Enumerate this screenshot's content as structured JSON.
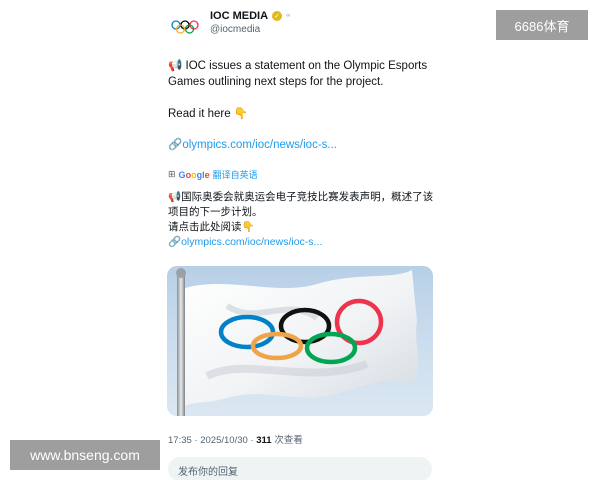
{
  "account": {
    "display_name": "IOC MEDIA",
    "handle": "@iocmedia",
    "verified_badge": "✓",
    "affiliate_badge": "∞"
  },
  "tweet": {
    "line1": "📢 IOC issues a statement on the Olympic Esports Games outlining next steps for the project.",
    "line2": "Read it here 👇",
    "link_prefix": "🔗",
    "link_text": "olympics.com/ioc/news/ioc-s..."
  },
  "translation": {
    "icon": "⊞",
    "google_letters": [
      "G",
      "o",
      "o",
      "g",
      "l",
      "e"
    ],
    "label": "翻译自英语",
    "line1": "📢国际奥委会就奥运会电子竞技比赛发表声明，概述了该项目的下一步计划。",
    "line2": "请点击此处阅读👇",
    "link_prefix": "🔗",
    "link_text": "olympics.com/ioc/news/ioc-s..."
  },
  "meta": {
    "time": "17:35",
    "date": "2025/10/30",
    "separator": "·",
    "views_count": "311",
    "views_label": "次查看"
  },
  "reply": {
    "placeholder": "发布你的回复"
  },
  "watermarks": {
    "top_right": "6686体育",
    "bottom_left": "www.bnseng.com"
  },
  "colors": {
    "accent": "#1d9bf0",
    "ring_blue": "#0081c8",
    "ring_yellow": "#fcb131",
    "ring_black": "#000000",
    "ring_green": "#00a651",
    "ring_red": "#ee334e"
  }
}
